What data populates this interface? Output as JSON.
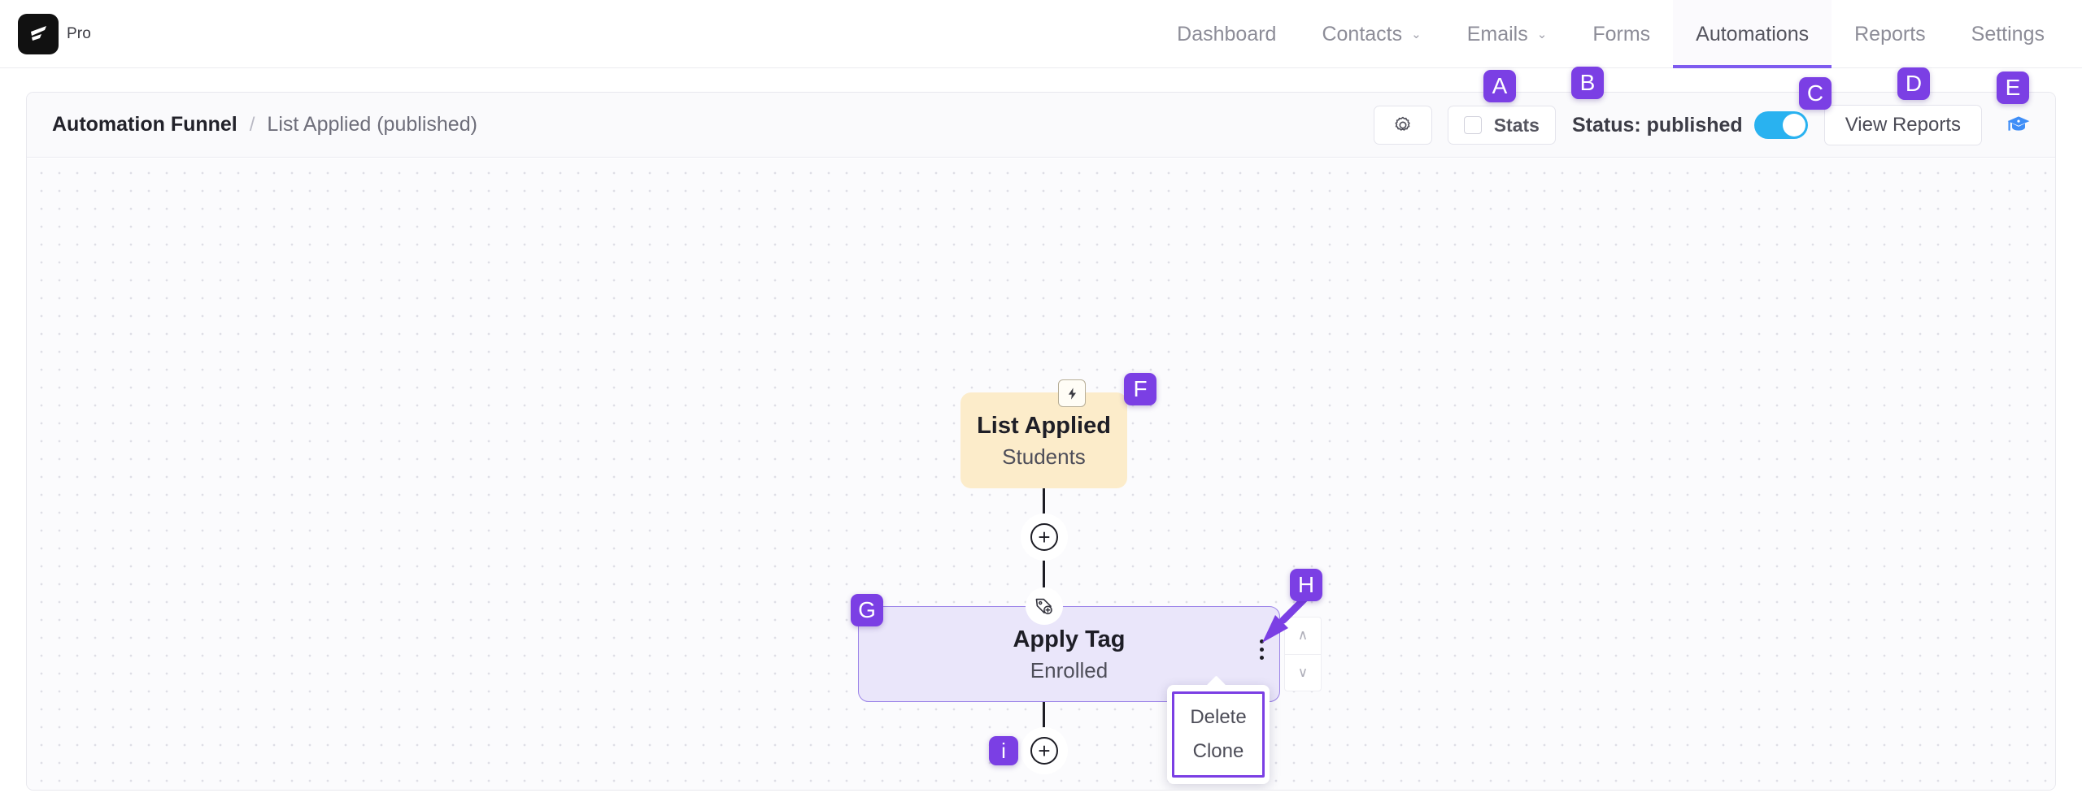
{
  "app": {
    "brand_label": "Pro",
    "logo_icon": "swoosh-logo-icon"
  },
  "nav": {
    "items": [
      {
        "label": "Dashboard",
        "has_caret": false,
        "active": false
      },
      {
        "label": "Contacts",
        "has_caret": true,
        "active": false
      },
      {
        "label": "Emails",
        "has_caret": true,
        "active": false
      },
      {
        "label": "Forms",
        "has_caret": false,
        "active": false
      },
      {
        "label": "Automations",
        "has_caret": false,
        "active": true
      },
      {
        "label": "Reports",
        "has_caret": false,
        "active": false
      },
      {
        "label": "Settings",
        "has_caret": false,
        "active": false
      }
    ],
    "caret_glyph": "⌄"
  },
  "breadcrumb": {
    "root": "Automation Funnel",
    "separator": "/",
    "leaf": "List Applied (published)"
  },
  "toolbar": {
    "settings_icon": "gear-icon",
    "stats_label": "Stats",
    "stats_checked": false,
    "status_label": "Status: published",
    "status_toggle_on": true,
    "toggle_color": "#29b2f0",
    "view_reports_label": "View Reports",
    "academy_icon": "graduation-cap-icon",
    "academy_icon_color": "#3f8ef7"
  },
  "canvas": {
    "trigger_node": {
      "icon": "lightning-bolt-icon",
      "title": "List Applied",
      "subtitle": "Students",
      "bg_color": "#fcecca"
    },
    "action_node": {
      "icon": "tag-plus-icon",
      "title": "Apply Tag",
      "subtitle": "Enrolled",
      "bg_color": "#eae6fa",
      "border_color": "#9b83e8",
      "kebab_icon": "vertical-dots-icon"
    },
    "add_buttons": [
      {
        "name": "add-step-upper",
        "glyph": "+"
      },
      {
        "name": "add-step-lower",
        "glyph": "+"
      }
    ],
    "reorder_controls": {
      "up_glyph": "∧",
      "down_glyph": "∨"
    },
    "context_menu": {
      "items": [
        {
          "label": "Delete"
        },
        {
          "label": "Clone"
        }
      ],
      "highlight_color": "#7b3fe4"
    }
  },
  "annotations": {
    "color": "#7b3fe4",
    "markers": [
      {
        "id": "A",
        "target": "settings-gear-button"
      },
      {
        "id": "B",
        "target": "stats-checkbox-button"
      },
      {
        "id": "C",
        "target": "status-toggle"
      },
      {
        "id": "D",
        "target": "view-reports-button"
      },
      {
        "id": "E",
        "target": "academy-button"
      },
      {
        "id": "F",
        "target": "trigger-node"
      },
      {
        "id": "G",
        "target": "action-node"
      },
      {
        "id": "H",
        "target": "node-kebab-menu"
      },
      {
        "id": "i",
        "target": "add-step-lower"
      }
    ]
  }
}
